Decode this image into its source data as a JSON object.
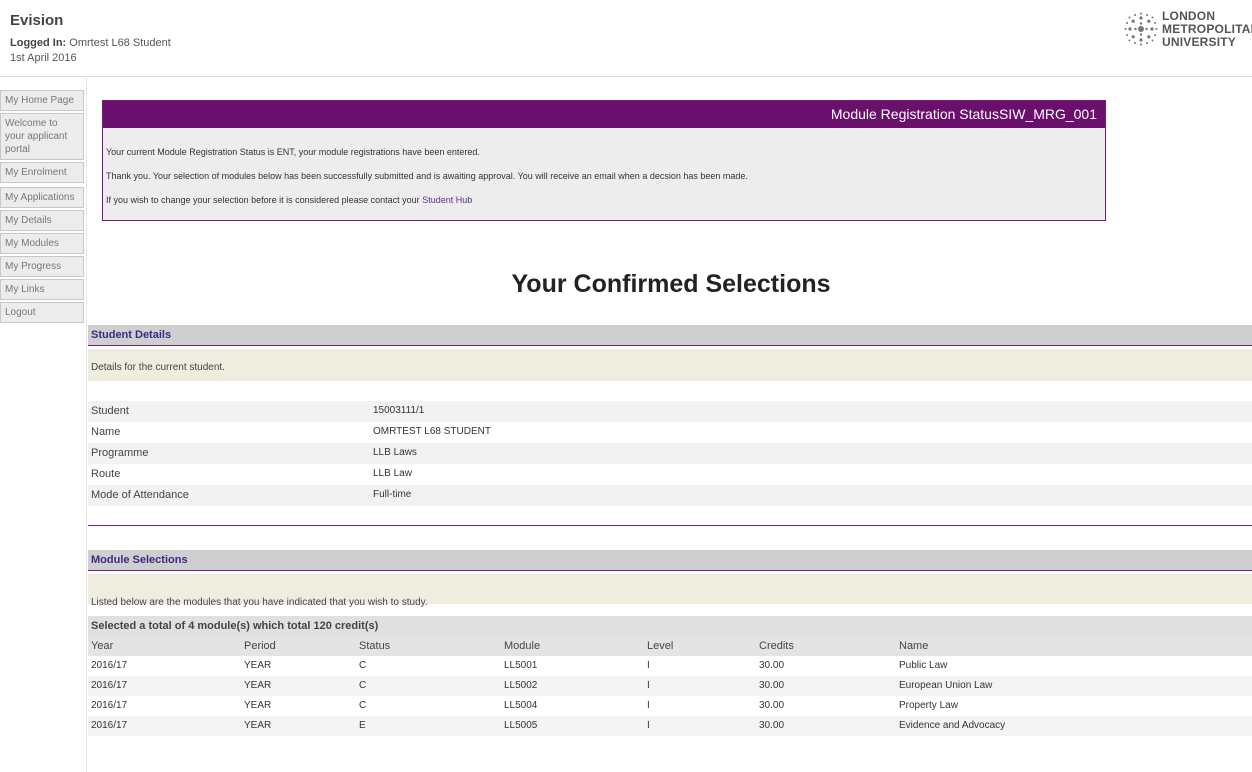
{
  "header": {
    "app_title": "Evision",
    "logged_in_label": "Logged In:",
    "user_name": "Omrtest L68 Student",
    "date": "1st April 2016",
    "logo_lines": [
      "LONDON",
      "METROPOLITAN",
      "UNIVERSITY"
    ]
  },
  "sidebar": {
    "items": [
      {
        "label": "My Home Page"
      },
      {
        "label": "Welcome to your applicant portal"
      },
      {
        "label": "My Enrolment"
      },
      {
        "label": "My Applications"
      },
      {
        "label": "My Details"
      },
      {
        "label": "My Modules"
      },
      {
        "label": "My Progress"
      },
      {
        "label": "My Links"
      },
      {
        "label": "Logout"
      }
    ]
  },
  "status_box": {
    "title": "Module Registration StatusSIW_MRG_001",
    "line1": "Your current Module Registration Status is ENT, your module registrations have been entered.",
    "line2": "Thank you. Your selection of modules below has been successfully submitted and is awaiting approval. You will receive an email when a decsion has been made.",
    "line3_prefix": "If you wish to change your selection before it is considered please contact your ",
    "line3_link": "Student Hub"
  },
  "page_title": "Your Confirmed Selections",
  "student_details": {
    "heading": "Student Details",
    "description": "Details for the current student.",
    "rows": [
      {
        "label": "Student",
        "value": "15003111/1"
      },
      {
        "label": "Name",
        "value": "OMRTEST L68 STUDENT"
      },
      {
        "label": "Programme",
        "value": "LLB Laws"
      },
      {
        "label": "Route",
        "value": "LLB Law"
      },
      {
        "label": "Mode of Attendance",
        "value": "Full-time"
      }
    ]
  },
  "module_selections": {
    "heading": "Module Selections",
    "description": "Listed below are the modules that you have indicated that you wish to study.",
    "summary": "Selected a total of 4 module(s) which total 120 credit(s)",
    "columns": [
      "Year",
      "Period",
      "Status",
      "Module",
      "Level",
      "Credits",
      "Name"
    ],
    "rows": [
      [
        "2016/17",
        "YEAR",
        "C",
        "LL5001",
        "I",
        "30.00",
        "Public Law"
      ],
      [
        "2016/17",
        "YEAR",
        "C",
        "LL5002",
        "I",
        "30.00",
        "European Union Law"
      ],
      [
        "2016/17",
        "YEAR",
        "C",
        "LL5004",
        "I",
        "30.00",
        "Property Law"
      ],
      [
        "2016/17",
        "YEAR",
        "E",
        "LL5005",
        "I",
        "30.00",
        "Evidence and Advocacy"
      ]
    ]
  },
  "colors": {
    "accent": "#6b0f6d",
    "link": "#5b2f8f",
    "panel_head_text": "#3a2a86"
  }
}
